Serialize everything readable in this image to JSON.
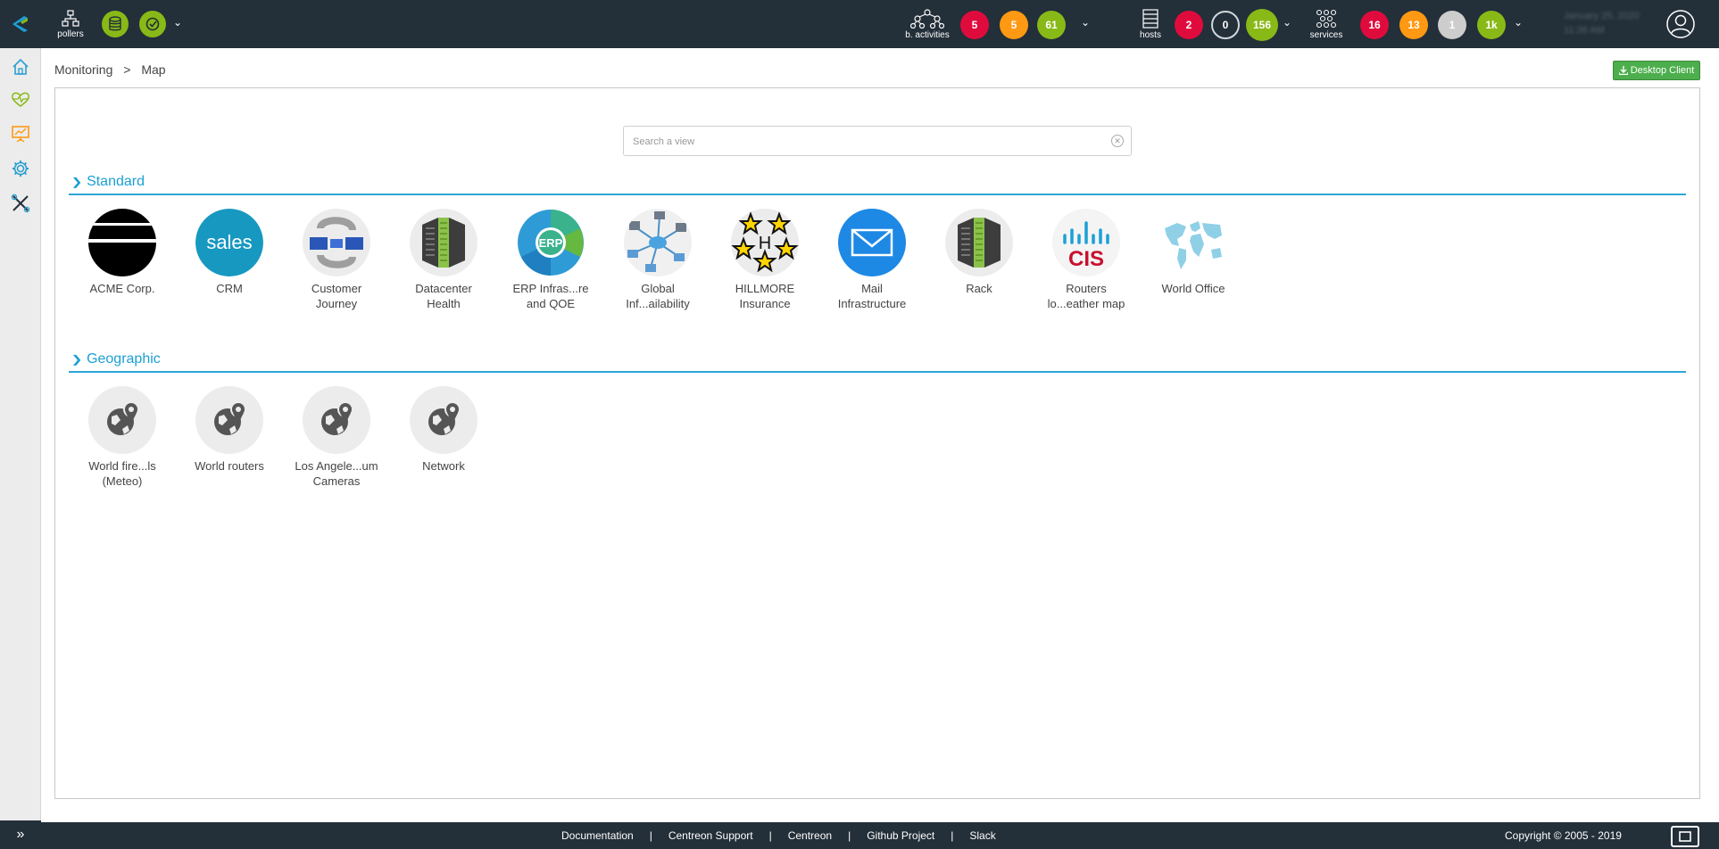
{
  "topbar": {
    "pollers_label": "pollers",
    "bactivities_label": "b. activities",
    "bactivities_counts": [
      "5",
      "5",
      "61"
    ],
    "hosts_label": "hosts",
    "hosts_counts": [
      "2",
      "0",
      "156"
    ],
    "services_label": "services",
    "services_counts": [
      "16",
      "13",
      "1",
      "1k"
    ],
    "clock_line1": "January 25, 2020",
    "clock_line2": "11:36 AM"
  },
  "breadcrumb": {
    "root": "Monitoring",
    "sep": ">",
    "current": "Map"
  },
  "desktop_client_label": "Desktop Client",
  "search": {
    "placeholder": "Search a view"
  },
  "sections": {
    "standard": {
      "title": "Standard",
      "items": [
        {
          "label": "ACME Corp."
        },
        {
          "label": "CRM"
        },
        {
          "label": "Customer\nJourney"
        },
        {
          "label": "Datacenter\nHealth"
        },
        {
          "label": "ERP Infras...re\nand QOE"
        },
        {
          "label": "Global\nInf...ailability"
        },
        {
          "label": "HILLMORE\nInsurance"
        },
        {
          "label": "Mail\nInfrastructure"
        },
        {
          "label": "Rack"
        },
        {
          "label": "Routers\nlo...eather map"
        },
        {
          "label": "World Office"
        }
      ]
    },
    "geographic": {
      "title": "Geographic",
      "items": [
        {
          "label": "World fire...ls\n(Meteo)"
        },
        {
          "label": "World routers"
        },
        {
          "label": "Los Angele...um\nCameras"
        },
        {
          "label": "Network"
        }
      ]
    }
  },
  "icon_texts": {
    "crm": "sales",
    "erp": "ERP",
    "hillmore": "H",
    "cisco": "CIS"
  },
  "footer": {
    "links": [
      "Documentation",
      "Centreon Support",
      "Centreon",
      "Github Project",
      "Slack"
    ],
    "separator": "|",
    "copyright": "Copyright © 2005 - 2019"
  },
  "colors": {
    "topbar_bg": "#232f39",
    "accent": "#1c9fd4",
    "critical": "#e00b3d",
    "warning": "#ff9913",
    "ok": "#88b917",
    "unknown": "#cdcdcd",
    "desktop_button": "#4cae4c"
  }
}
